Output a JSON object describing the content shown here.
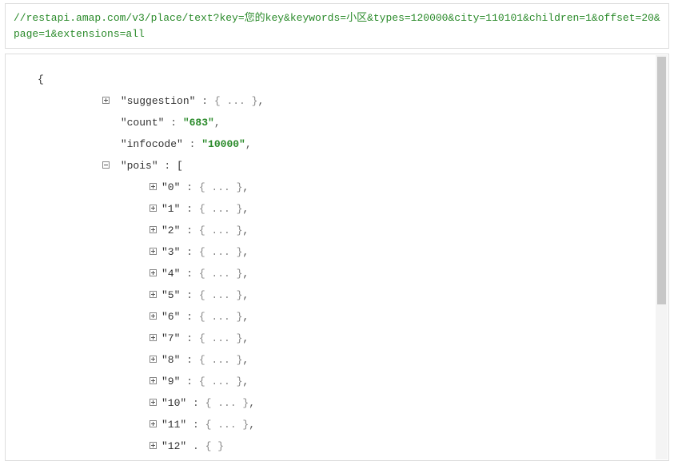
{
  "url": "//restapi.amap.com/v3/place/text?key=您的key&keywords=小区&types=120000&city=110101&children=1&offset=20&page=1&extensions=all",
  "open_brace": "{",
  "fields": {
    "suggestion": {
      "key": "\"suggestion\"",
      "colon": " :  ",
      "value": "{ ... }",
      "comma": ","
    },
    "count": {
      "key": "\"count\"",
      "colon": " :  ",
      "value": "\"683\"",
      "comma": ","
    },
    "infocode": {
      "key": "\"infocode\"",
      "colon": " :  ",
      "value": "\"10000\"",
      "comma": ","
    },
    "pois": {
      "key": "\"pois\"",
      "colon": " :  ",
      "value": "["
    }
  },
  "pois_items": [
    {
      "key": "\"0\"",
      "colon": " :  ",
      "value": "{ ... }",
      "comma": ","
    },
    {
      "key": "\"1\"",
      "colon": " :  ",
      "value": "{ ... }",
      "comma": ","
    },
    {
      "key": "\"2\"",
      "colon": " :  ",
      "value": "{ ... }",
      "comma": ","
    },
    {
      "key": "\"3\"",
      "colon": " :  ",
      "value": "{ ... }",
      "comma": ","
    },
    {
      "key": "\"4\"",
      "colon": " :  ",
      "value": "{ ... }",
      "comma": ","
    },
    {
      "key": "\"5\"",
      "colon": " :  ",
      "value": "{ ... }",
      "comma": ","
    },
    {
      "key": "\"6\"",
      "colon": " :  ",
      "value": "{ ... }",
      "comma": ","
    },
    {
      "key": "\"7\"",
      "colon": " :  ",
      "value": "{ ... }",
      "comma": ","
    },
    {
      "key": "\"8\"",
      "colon": " :  ",
      "value": "{ ... }",
      "comma": ","
    },
    {
      "key": "\"9\"",
      "colon": " :  ",
      "value": "{ ... }",
      "comma": ","
    },
    {
      "key": "\"10\"",
      "colon": " :  ",
      "value": "{ ... }",
      "comma": ","
    },
    {
      "key": "\"11\"",
      "colon": " :  ",
      "value": "{ ... }",
      "comma": ","
    },
    {
      "key": "\"12\"",
      "colon": " .  ",
      "value": "{ }",
      "comma": ""
    }
  ]
}
